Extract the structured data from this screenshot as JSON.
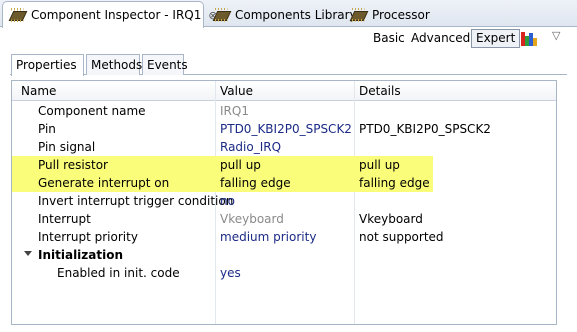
{
  "view_tabs": [
    {
      "label": "Component Inspector - IRQ1",
      "close": "⊗"
    },
    {
      "label": "Components Library"
    },
    {
      "label": "Processor"
    }
  ],
  "toolbar": {
    "basic": "Basic",
    "advanced": "Advanced",
    "expert": "Expert",
    "menu_glyph": "▽",
    "chart_colors": [
      "#d7261e",
      "#2c9c3c",
      "#2b5fd1",
      "#e2a51b"
    ]
  },
  "sub_tabs": [
    "Properties",
    "Methods",
    "Events"
  ],
  "columns": [
    "Name",
    "Value",
    "Details"
  ],
  "highlight_color": "#fafd7a",
  "rows": [
    {
      "name": "Component name",
      "value": "IRQ1",
      "details": ""
    },
    {
      "name": "Pin",
      "value": "PTD0_KBI2P0_SPSCK2",
      "details": "PTD0_KBI2P0_SPSCK2"
    },
    {
      "name": "Pin signal",
      "value": "Radio_IRQ",
      "details": ""
    },
    {
      "name": "Pull resistor",
      "value": "pull up",
      "details": "pull up"
    },
    {
      "name": "Generate interrupt on",
      "value": "falling edge",
      "details": "falling edge"
    },
    {
      "name": "Invert interrupt trigger condition",
      "value": "no",
      "details": ""
    },
    {
      "name": "Interrupt",
      "value": "Vkeyboard",
      "details": "Vkeyboard"
    },
    {
      "name": "Interrupt priority",
      "value": "medium priority",
      "details": "not supported"
    },
    {
      "name": "Initialization",
      "value": "",
      "details": ""
    },
    {
      "name": "Enabled in init. code",
      "value": "yes",
      "details": ""
    }
  ]
}
